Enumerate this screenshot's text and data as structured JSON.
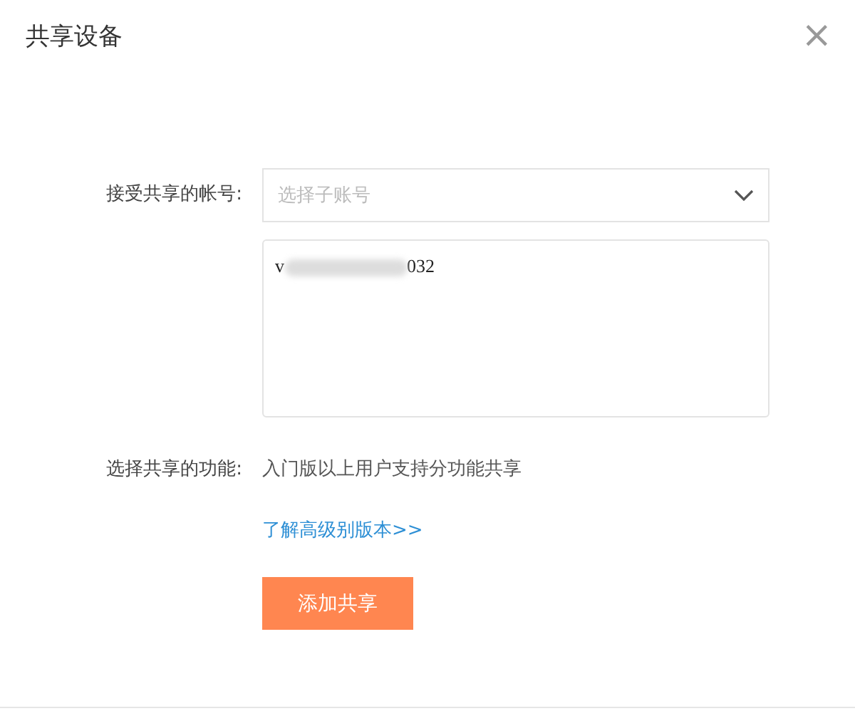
{
  "dialog": {
    "title": "共享设备",
    "close": "×"
  },
  "account": {
    "label": "接受共享的帐号:",
    "select": {
      "placeholder": "选择子账号"
    },
    "list": {
      "value_start": "v",
      "value_end": "032",
      "redacted": true
    }
  },
  "feature": {
    "label": "选择共享的功能:",
    "note": "入门版以上用户支持分功能共享",
    "link": "了解高级别版本>>"
  },
  "submit": "添加共享"
}
